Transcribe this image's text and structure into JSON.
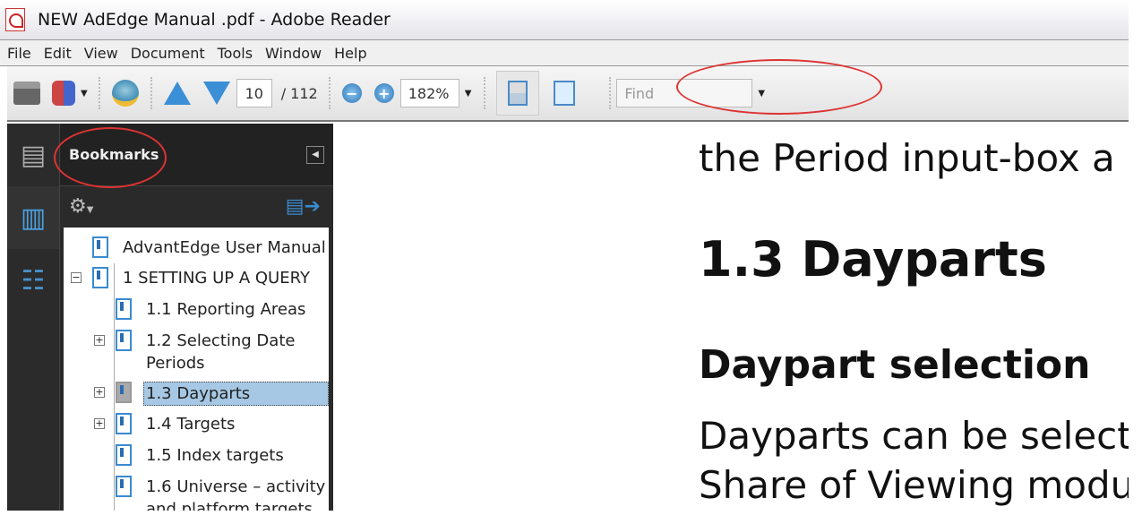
{
  "window": {
    "title": "NEW AdEdge Manual .pdf - Adobe Reader"
  },
  "menu": [
    "File",
    "Edit",
    "View",
    "Document",
    "Tools",
    "Window",
    "Help"
  ],
  "toolbar": {
    "page_current": "10",
    "page_total": "/ 112",
    "zoom": "182%",
    "find_placeholder": "Find"
  },
  "panel": {
    "title": "Bookmarks"
  },
  "bookmarks": [
    {
      "label": "AdvantEdge User Manual"
    },
    {
      "label": "1 SETTING UP A QUERY"
    },
    {
      "label": "1.1 Reporting Areas"
    },
    {
      "label": "1.2 Selecting Date Periods"
    },
    {
      "label": "1.3 Dayparts"
    },
    {
      "label": "1.4 Targets"
    },
    {
      "label": "1.5 Index targets"
    },
    {
      "label": "1.6 Universe – activity and platform targets"
    }
  ],
  "document": {
    "line1": "the Period input-box a",
    "heading": "1.3  Dayparts",
    "subheading": "Daypart selection",
    "para1": "Dayparts can be select",
    "para2": "Share of Viewing modu"
  }
}
